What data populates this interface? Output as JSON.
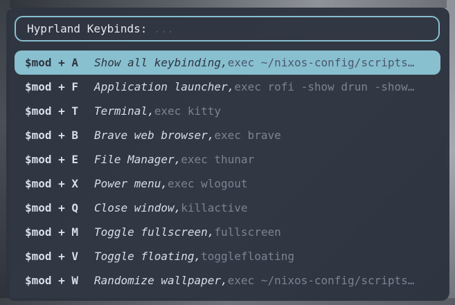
{
  "search": {
    "prompt": "Hyprland Keybinds:",
    "placeholder": "..."
  },
  "colors": {
    "accent": "#88c0d0",
    "window_bg": "#2e3440",
    "text": "#d8dee9",
    "muted": "#7b8394"
  },
  "keybinds": [
    {
      "key": "$mod + A",
      "desc": "Show all keybinding,",
      "cmd": "exec ~/nixos-config/scripts…",
      "selected": true
    },
    {
      "key": "$mod + F",
      "desc": "Application launcher,",
      "cmd": "exec rofi -show drun -show…"
    },
    {
      "key": "$mod + T",
      "desc": "Terminal,",
      "cmd": "exec kitty"
    },
    {
      "key": "$mod + B",
      "desc": "Brave web browser,",
      "cmd": "exec brave"
    },
    {
      "key": "$mod + E",
      "desc": "File Manager,",
      "cmd": "exec thunar"
    },
    {
      "key": "$mod + X",
      "desc": "Power menu,",
      "cmd": "exec wlogout"
    },
    {
      "key": "$mod + Q",
      "desc": "Close window,",
      "cmd": "killactive"
    },
    {
      "key": "$mod + M",
      "desc": "Toggle fullscreen,",
      "cmd": "fullscreen"
    },
    {
      "key": "$mod + V",
      "desc": "Toggle floating,",
      "cmd": "togglefloating"
    },
    {
      "key": "$mod + W",
      "desc": "Randomize wallpaper,",
      "cmd": "exec ~/nixos-config/scripts…"
    }
  ]
}
